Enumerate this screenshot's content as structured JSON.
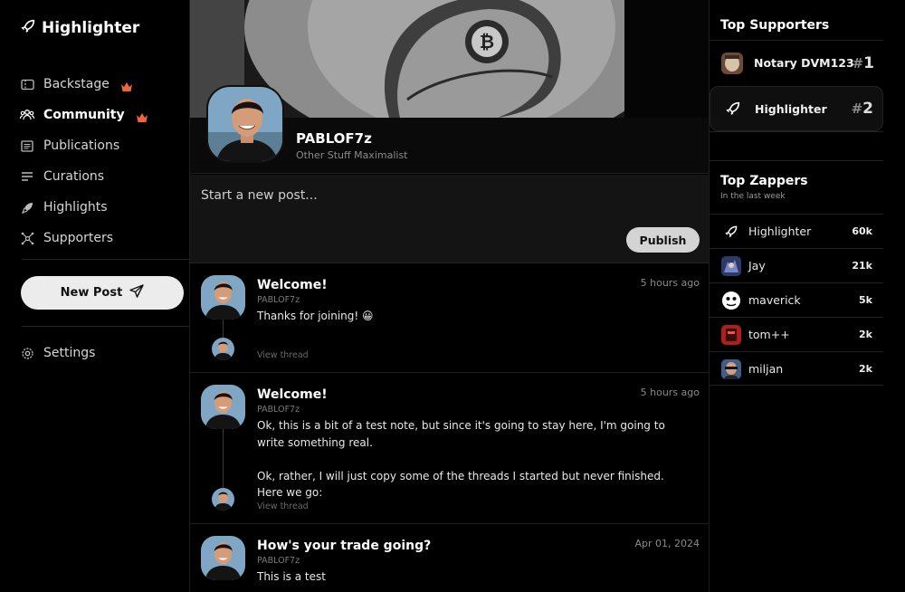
{
  "app": {
    "name": "Highlighter"
  },
  "colors": {
    "accent": "#f2653a",
    "background": "#000000",
    "button": "#ececec"
  },
  "nav": {
    "items": [
      {
        "label": "Backstage",
        "icon": "ticket-icon",
        "badge": "crown-icon"
      },
      {
        "label": "Community",
        "icon": "users-icon",
        "badge": "crown-icon",
        "active": true
      },
      {
        "label": "Publications",
        "icon": "newspaper-icon"
      },
      {
        "label": "Curations",
        "icon": "list-icon"
      },
      {
        "label": "Highlights",
        "icon": "highlighter-icon"
      },
      {
        "label": "Supporters",
        "icon": "network-icon"
      }
    ],
    "new_post_label": "New Post",
    "settings_label": "Settings"
  },
  "profile": {
    "name": "PABLOF7z",
    "tagline": "Other Stuff Maximalist"
  },
  "composer": {
    "placeholder": "Start a new post...",
    "publish_label": "Publish"
  },
  "posts": [
    {
      "title": "Welcome!",
      "author": "PABLOF7z",
      "body": "Thanks for joining! 😀",
      "time": "5 hours ago",
      "view_thread": "View thread"
    },
    {
      "title": "Welcome!",
      "author": "PABLOF7z",
      "body": "Ok, this is a bit of a test note, but since it's going to stay here, I'm going to write something real.\n\nOk, rather, I will just copy some of the threads I started but never finished. Here we go:",
      "time": "5 hours ago",
      "view_thread": "View thread"
    },
    {
      "title": "How's your trade going?",
      "author": "PABLOF7z",
      "body": "This is a test",
      "time": "Apr 01, 2024"
    }
  ],
  "top_supporters": {
    "title": "Top Supporters",
    "items": [
      {
        "name": "Notary DVM123",
        "hash": "#",
        "rank": "1"
      },
      {
        "name": "Highlighter",
        "hash": "#",
        "rank": "2"
      }
    ]
  },
  "top_zappers": {
    "title": "Top Zappers",
    "subtitle": "In the last week",
    "items": [
      {
        "name": "Highlighter",
        "amount": "60k"
      },
      {
        "name": "Jay",
        "amount": "21k"
      },
      {
        "name": "maverick",
        "amount": "5k"
      },
      {
        "name": "tom++",
        "amount": "2k"
      },
      {
        "name": "miljan",
        "amount": "2k"
      }
    ]
  }
}
